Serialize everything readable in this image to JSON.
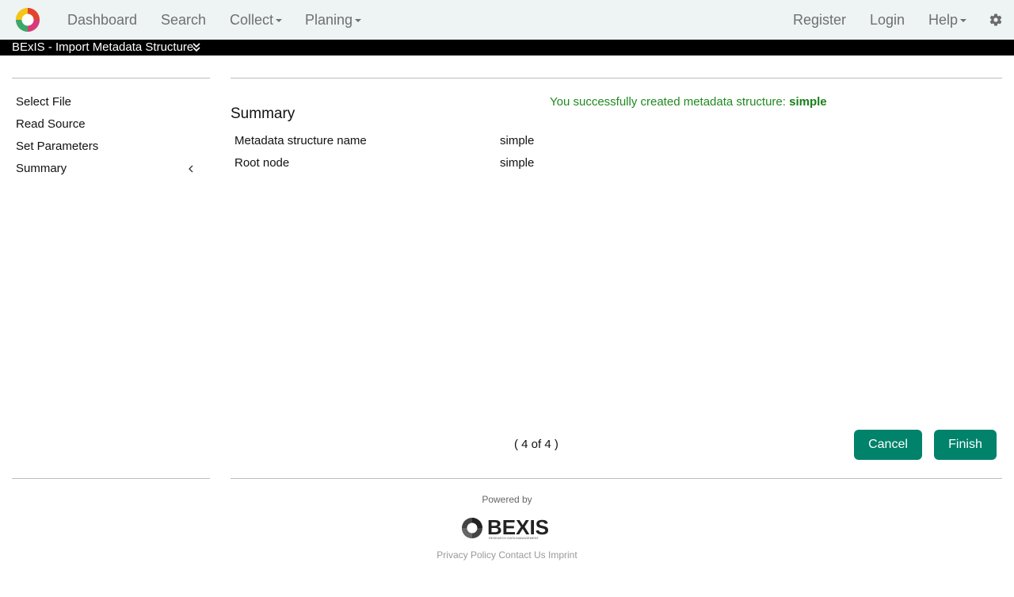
{
  "nav": {
    "left": [
      "Dashboard",
      "Search",
      "Collect",
      "Planing"
    ],
    "right": [
      "Register",
      "Login",
      "Help"
    ]
  },
  "page": {
    "title": "BExIS - Import Metadata Structure"
  },
  "sidebar": {
    "items": [
      "Select File",
      "Read Source",
      "Set Parameters",
      "Summary"
    ],
    "active": "Summary"
  },
  "main": {
    "success_prefix": "You successfully created metadata structure:",
    "success_name": "simple",
    "section_title": "Summary",
    "rows": [
      {
        "label": "Metadata structure name",
        "value": "simple"
      },
      {
        "label": "Root node",
        "value": "simple"
      }
    ],
    "pager": "( 4 of 4 )",
    "cancel_label": "Cancel",
    "finish_label": "Finish"
  },
  "footer": {
    "powered_by": "Powered by",
    "logo_text": "BEXIS",
    "logo_subtext": "RESEARCH DATA MANAGEMENT",
    "links": [
      "Privacy Policy",
      "Contact Us",
      "Imprint"
    ]
  },
  "colors": {
    "accent": "#00826b",
    "success": "#1f8a1f",
    "navbar_bg": "#eef3f3",
    "titlebar_bg": "#000000"
  },
  "icons": [
    "app-logo-icon",
    "caret-down-icon",
    "gear-icon",
    "double-chevron-down-icon",
    "chevron-left-icon",
    "bexis-logo-icon"
  ]
}
